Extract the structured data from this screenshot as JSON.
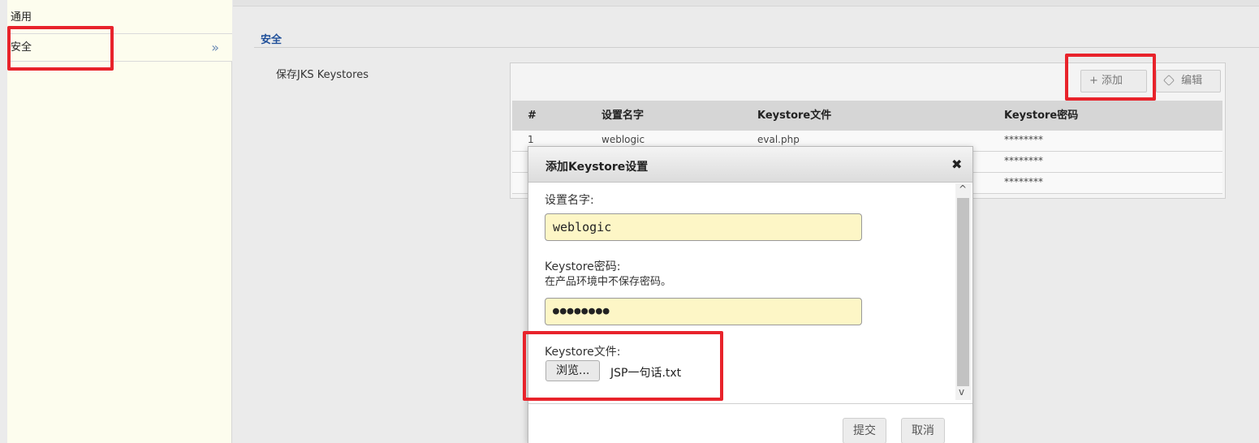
{
  "sidebar": {
    "items": [
      {
        "label": "通用"
      },
      {
        "label": "安全",
        "chevron": "»"
      }
    ]
  },
  "main": {
    "section_title": "安全",
    "jks_label": "保存JKS Keystores",
    "toolbar": {
      "add_label": "+ 添加",
      "edit_icon": "tag-icon",
      "edit_label": "编辑"
    },
    "table": {
      "headers": [
        "#",
        "设置名字",
        "Keystore文件",
        "Keystore密码"
      ],
      "rows": [
        [
          "1",
          "weblogic",
          "eval.php",
          "********"
        ],
        [
          "",
          "",
          "",
          "********"
        ],
        [
          "",
          "",
          "",
          "********"
        ]
      ]
    }
  },
  "modal": {
    "title": "添加Keystore设置",
    "close": "✖",
    "name_label": "设置名字:",
    "name_value": "weblogic",
    "password_label": "Keystore密码:",
    "password_hint": "在产品环境中不保存密码。",
    "password_value": "●●●●●●●●",
    "file_label": "Keystore文件:",
    "browse_label": "浏览...",
    "file_name": "JSP一句话.txt",
    "submit_label": "提交",
    "cancel_label": "取消"
  },
  "colors": {
    "highlight": "#e8232b",
    "section_title": "#1f4f99",
    "input_bg": "#fdf6c6"
  }
}
